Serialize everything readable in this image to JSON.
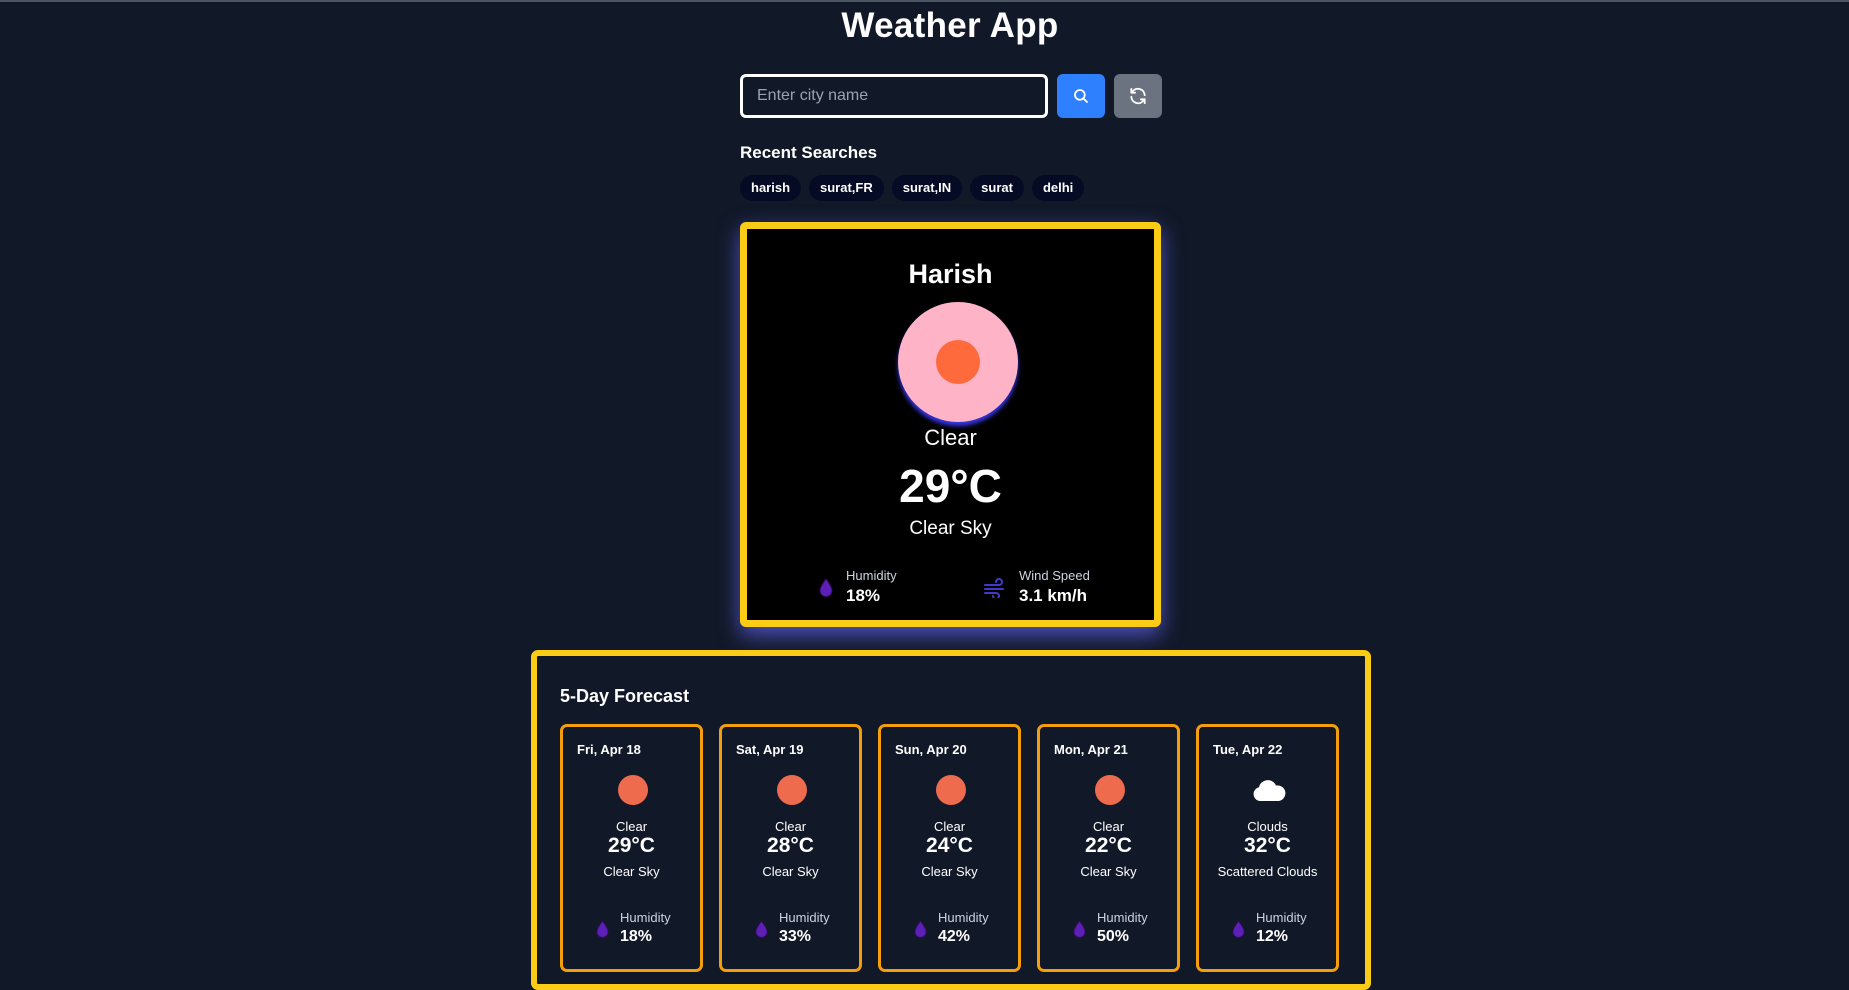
{
  "app": {
    "title": "Weather App"
  },
  "search": {
    "placeholder": "Enter city name"
  },
  "icons": {
    "search": "search-icon",
    "refresh": "refresh-icon",
    "humidity": "droplet-icon",
    "wind": "wind-icon",
    "clear": "sun-icon",
    "clouds": "cloud-icon"
  },
  "recent": {
    "title": "Recent Searches",
    "items": [
      "harish",
      "surat,FR",
      "surat,IN",
      "surat",
      "delhi"
    ]
  },
  "current": {
    "city": "Harish",
    "condition": "Clear",
    "temperature": "29°C",
    "description": "Clear Sky",
    "humidity_label": "Humidity",
    "humidity": "18%",
    "wind_label": "Wind Speed",
    "wind": "3.1 km/h"
  },
  "forecast": {
    "title": "5-Day Forecast",
    "days": [
      {
        "date": "Fri, Apr 18",
        "icon": "sun-icon",
        "condition": "Clear",
        "temperature": "29°C",
        "description": "Clear Sky",
        "humidity_label": "Humidity",
        "humidity": "18%"
      },
      {
        "date": "Sat, Apr 19",
        "icon": "sun-icon",
        "condition": "Clear",
        "temperature": "28°C",
        "description": "Clear Sky",
        "humidity_label": "Humidity",
        "humidity": "33%"
      },
      {
        "date": "Sun, Apr 20",
        "icon": "sun-icon",
        "condition": "Clear",
        "temperature": "24°C",
        "description": "Clear Sky",
        "humidity_label": "Humidity",
        "humidity": "42%"
      },
      {
        "date": "Mon, Apr 21",
        "icon": "sun-icon",
        "condition": "Clear",
        "temperature": "22°C",
        "description": "Clear Sky",
        "humidity_label": "Humidity",
        "humidity": "50%"
      },
      {
        "date": "Tue, Apr 22",
        "icon": "cloud-icon",
        "condition": "Clouds",
        "temperature": "32°C",
        "description": "Scattered Clouds",
        "humidity_label": "Humidity",
        "humidity": "12%"
      }
    ]
  },
  "colors": {
    "background": "#111827",
    "accent_border": "#facc15",
    "day_border": "#f59e0b",
    "search_button": "#2f80ff",
    "refresh_button": "#6b7280",
    "sun": "#ff6a3d",
    "humidity_icon": "#5b21b6"
  }
}
